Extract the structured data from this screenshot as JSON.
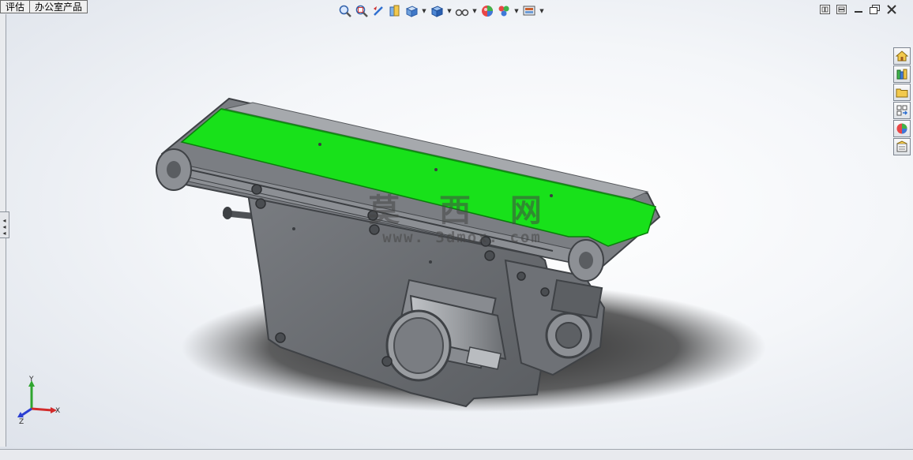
{
  "tabs": [
    {
      "label": "评估"
    },
    {
      "label": "办公室产品"
    }
  ],
  "heads_up_toolbar": {
    "icons": [
      {
        "name": "zoom-to-fit-icon",
        "dropdown": false
      },
      {
        "name": "zoom-to-area-icon",
        "dropdown": false
      },
      {
        "name": "previous-view-icon",
        "dropdown": false
      },
      {
        "name": "section-view-icon",
        "dropdown": false
      },
      {
        "name": "view-orientation-icon",
        "dropdown": true
      },
      {
        "name": "display-style-icon",
        "dropdown": true
      },
      {
        "name": "hide-show-items-icon",
        "dropdown": true
      },
      {
        "name": "edit-appearance-icon",
        "dropdown": false
      },
      {
        "name": "apply-scene-icon",
        "dropdown": true
      },
      {
        "name": "view-settings-icon",
        "dropdown": true
      }
    ]
  },
  "window_controls": [
    "viewport-1-icon",
    "viewport-2-icon",
    "minimize-icon",
    "restore-icon",
    "close-icon"
  ],
  "task_pane": [
    "home-icon",
    "design-library-icon",
    "file-explorer-icon",
    "view-palette-icon",
    "appearances-icon",
    "custom-properties-icon"
  ],
  "triad": {
    "x_label": "X",
    "y_label": "Y",
    "z_label": "Z"
  },
  "watermark": {
    "chinese": "莫 西 网",
    "url": "www. 3dmox. com"
  },
  "colors": {
    "belt": "#18e11a",
    "frame": "#6b6e72",
    "accent": "#2f6fd0"
  }
}
